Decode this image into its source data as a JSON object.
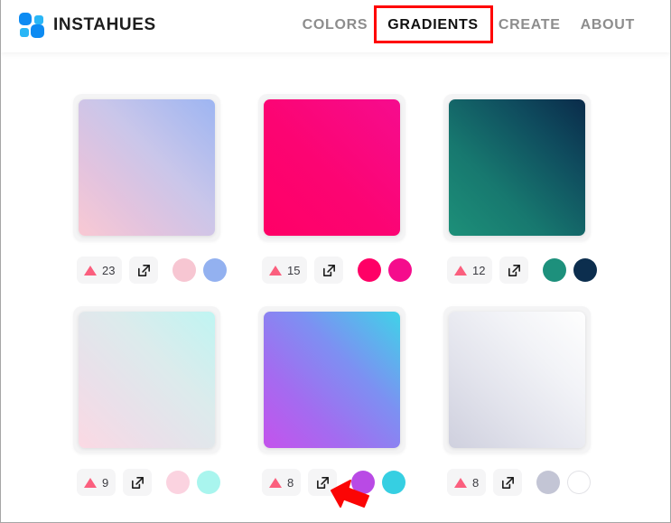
{
  "header": {
    "brand_name": "INSTAHUES",
    "logo_icon": "logo-squares-icon",
    "nav": [
      {
        "label": "COLORS",
        "active": false
      },
      {
        "label": "GRADIENTS",
        "active": true
      },
      {
        "label": "CREATE",
        "active": false
      },
      {
        "label": "ABOUT",
        "active": false
      }
    ],
    "annotation_target": "GRADIENTS",
    "annotation_color": "#ff0000"
  },
  "icons": {
    "upvote": "triangle-up-icon",
    "share": "external-link-icon",
    "cursor": "cursor-arrow-icon"
  },
  "gradients": [
    {
      "name": "gradient-card-1",
      "votes": "23",
      "css": "linear-gradient(45deg, #f9c9d3 0%, #e3c3de 28%, #c9c6ea 58%, #9db5f2 100%)",
      "colors": [
        "#f7c6d2",
        "#93b1f0"
      ]
    },
    {
      "name": "gradient-card-2",
      "votes": "15",
      "css": "linear-gradient(45deg, #ff0066 0%, #fc0472 45%, #f60c8e 100%)",
      "colors": [
        "#ff0066",
        "#f50c8c"
      ]
    },
    {
      "name": "gradient-card-3",
      "votes": "12",
      "css": "linear-gradient(45deg, #1d9079 0%, #17786f 35%, #0f4c5e 72%, #0a2b4a 100%)",
      "colors": [
        "#1d907c",
        "#0c2e4e"
      ]
    },
    {
      "name": "gradient-card-4",
      "votes": "9",
      "css": "linear-gradient(45deg, #fbd9e3 0%, #eae0ea 30%, #dcebec 62%, #bff5f2 100%)",
      "colors": [
        "#fbd3e0",
        "#a9f5ee"
      ]
    },
    {
      "name": "gradient-card-5",
      "votes": "8",
      "css": "linear-gradient(45deg, #c453ec 0%, #a46bf0 30%, #7d90f2 62%, #3fd3e8 100%)",
      "colors": [
        "#b94ae5",
        "#36cfe2"
      ]
    },
    {
      "name": "gradient-card-6",
      "votes": "8",
      "css": "linear-gradient(45deg, #cfd0de 0%, #e2e3ec 35%, #f2f3f7 68%, #fefefe 100%)",
      "colors": [
        "#c3c5d5",
        "#ffffff"
      ]
    }
  ]
}
